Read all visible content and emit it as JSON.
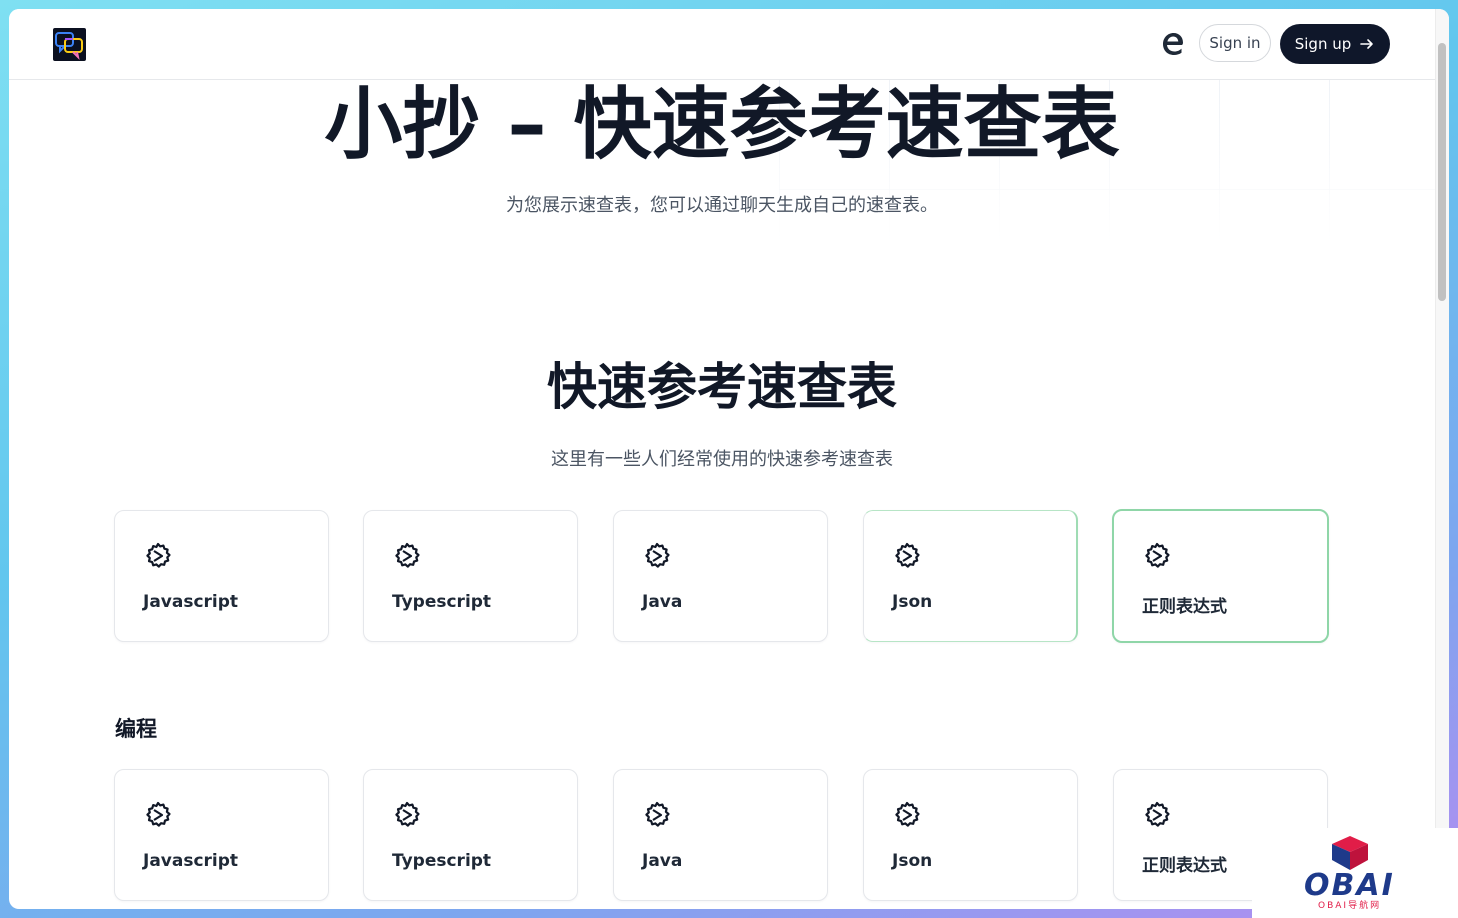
{
  "header": {
    "signin_label": "Sign in",
    "signup_label": "Sign up",
    "logo_icon": "chat-bubbles-logo-icon",
    "browser_icon": "edge-e-icon"
  },
  "hero": {
    "title": "小抄 – 快速参考速查表",
    "subtitle": "为您展示速查表，您可以通过聊天生成自己的速查表。"
  },
  "section": {
    "title": "快速参考速查表",
    "subtitle": "这里有一些人们经常使用的快速参考速查表"
  },
  "featured": [
    {
      "label": "Javascript",
      "icon": "gear-icon"
    },
    {
      "label": "Typescript",
      "icon": "gear-icon"
    },
    {
      "label": "Java",
      "icon": "gear-icon"
    },
    {
      "label": "Json",
      "icon": "gear-icon"
    },
    {
      "label": "正则表达式",
      "icon": "gear-icon"
    }
  ],
  "groups": [
    {
      "label": "编程",
      "items": [
        {
          "label": "Javascript",
          "icon": "gear-icon"
        },
        {
          "label": "Typescript",
          "icon": "gear-icon"
        },
        {
          "label": "Java",
          "icon": "gear-icon"
        },
        {
          "label": "Json",
          "icon": "gear-icon"
        },
        {
          "label": "正则表达式",
          "icon": "gear-icon"
        }
      ]
    }
  ],
  "watermark": {
    "brand": "OBAI",
    "tagline": "OBAI导航网"
  },
  "colors": {
    "primary_dark": "#0f172a",
    "highlight_green": "#8fd6a8",
    "text_dark": "#111827",
    "text_muted": "#4b5563"
  }
}
